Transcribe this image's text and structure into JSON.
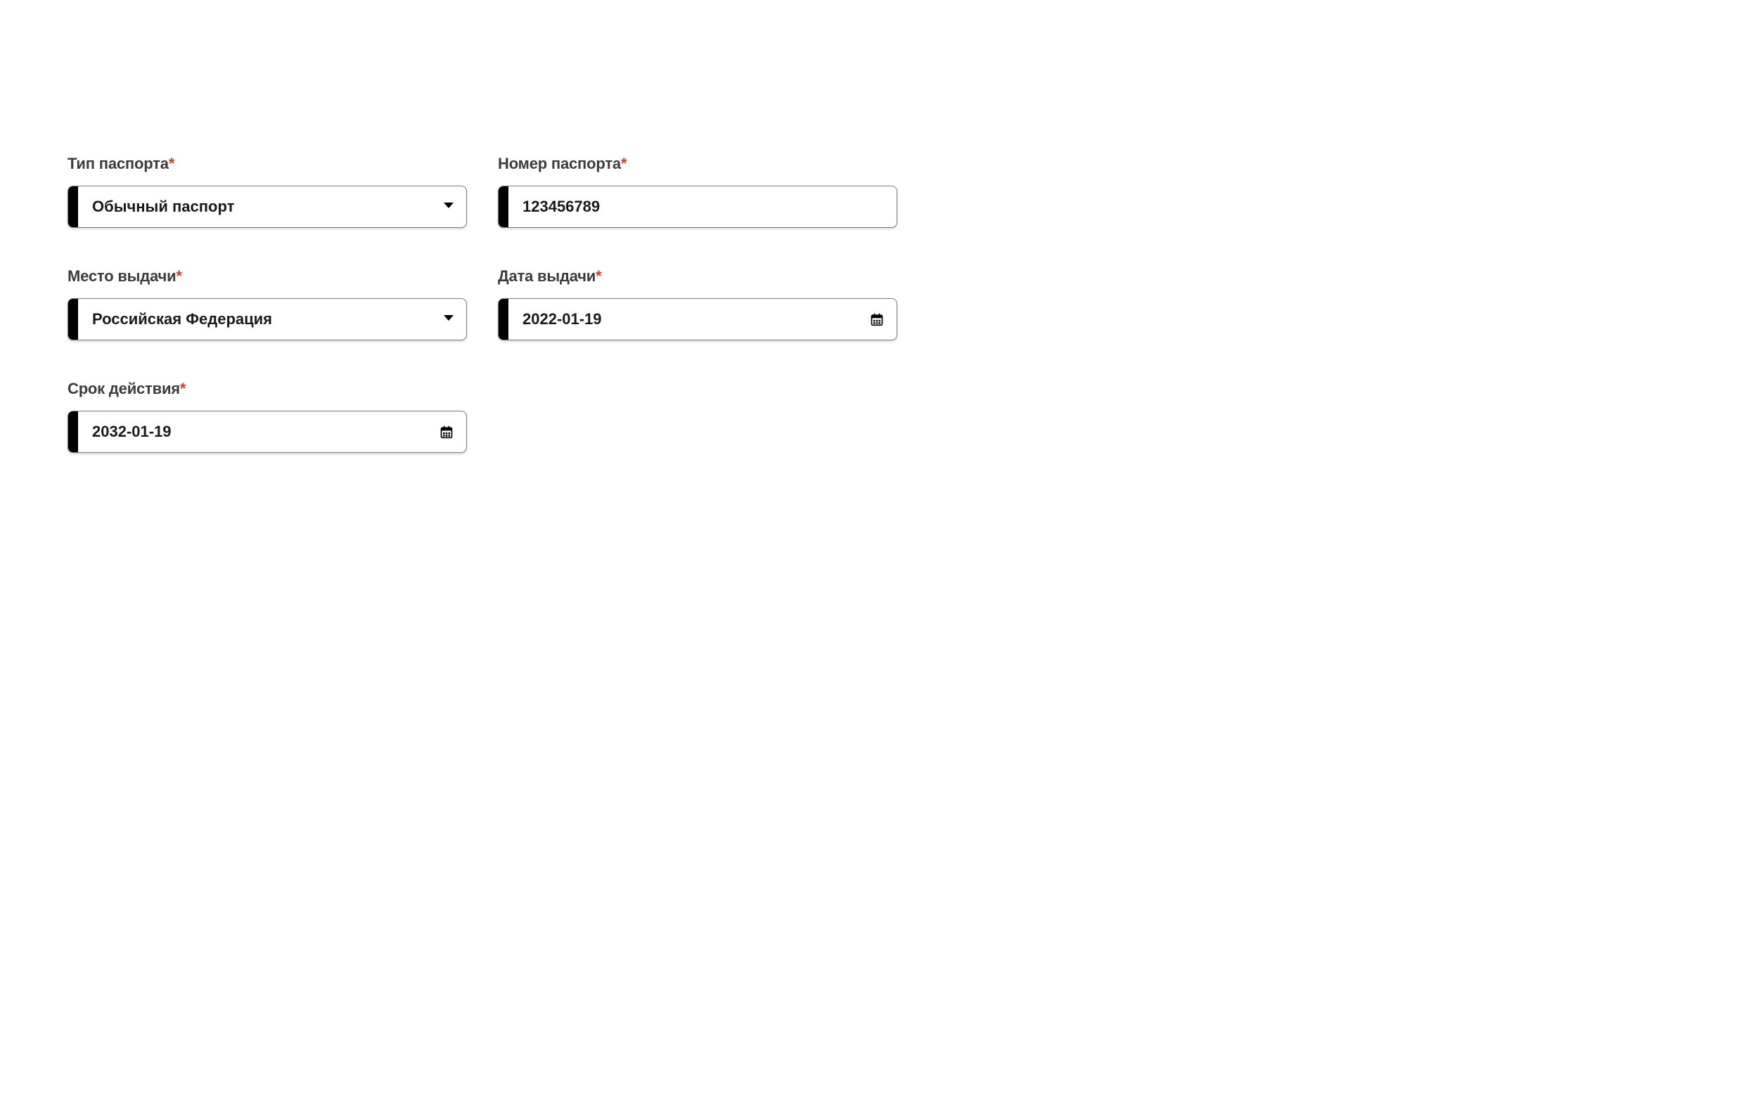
{
  "fields": {
    "passport_type": {
      "label": "Тип паспорта",
      "required": "*",
      "value": "Обычный паспорт"
    },
    "passport_number": {
      "label": "Номер паспорта",
      "required": "*",
      "value": "123456789"
    },
    "issue_place": {
      "label": "Место выдачи",
      "required": "*",
      "value": "Российская Федерация"
    },
    "issue_date": {
      "label": "Дата выдачи",
      "required": "*",
      "value": "2022-01-19"
    },
    "expiry_date": {
      "label": "Срок действия",
      "required": "*",
      "value": "2032-01-19"
    }
  }
}
